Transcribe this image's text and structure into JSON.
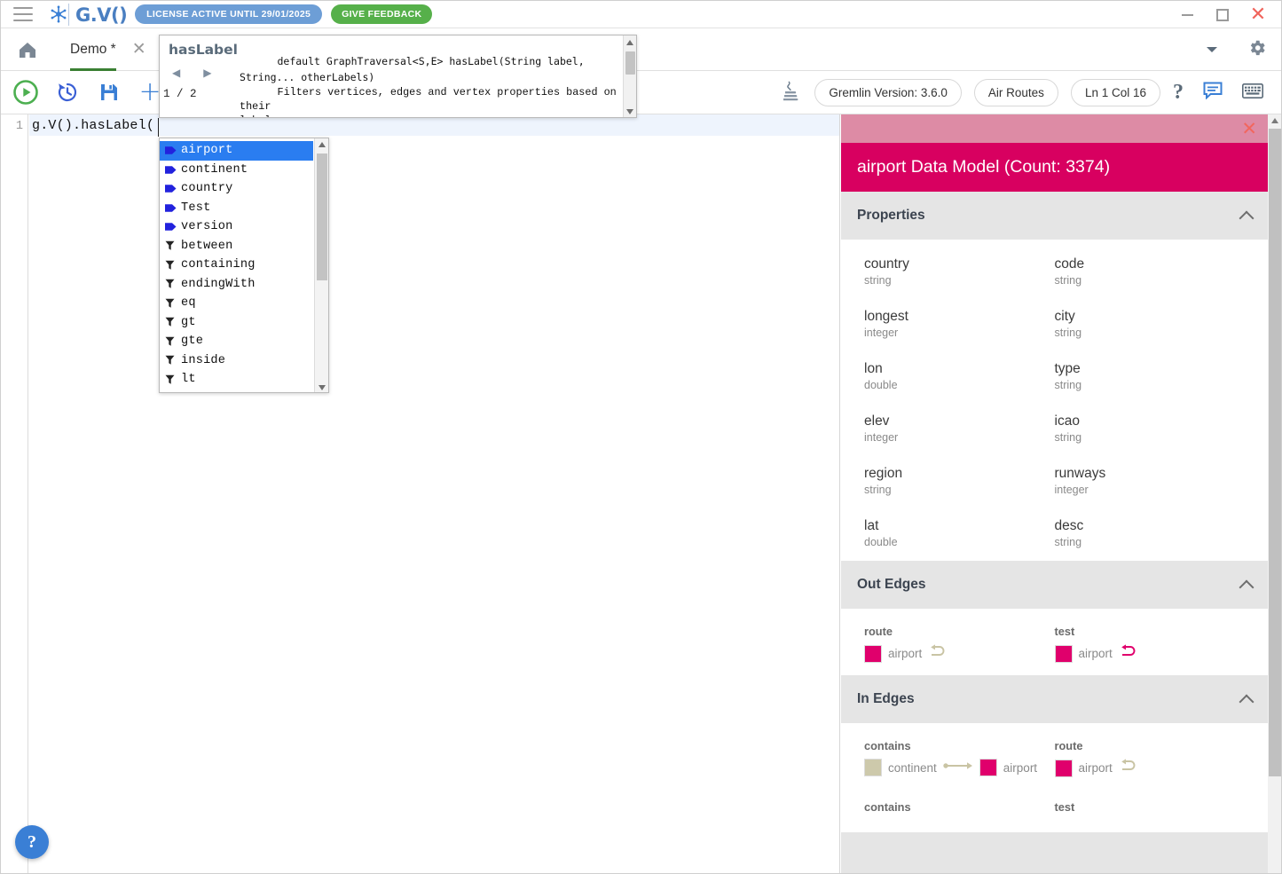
{
  "titlebar": {
    "menu_icon": "hamburger-icon",
    "brand": "G.V()",
    "license_badge": "LICENSE ACTIVE UNTIL 29/01/2025",
    "feedback_button": "GIVE FEEDBACK",
    "window_controls": {
      "minimize": "minimize-icon",
      "maximize": "maximize-icon",
      "close": "close-icon"
    },
    "colors": {
      "brand_blue": "#4a7fc1",
      "license_blue": "#6d9ed6",
      "feedback_green": "#56b04a",
      "close_red": "#f0645c"
    }
  },
  "tabbar": {
    "home_icon": "home-icon",
    "tabs": [
      {
        "label": "Demo *",
        "active": true,
        "close_icon": "close-icon"
      }
    ],
    "overflow_icon": "chevron-down-icon",
    "settings_icon": "gear-icon",
    "active_underline_color": "#3a7f33"
  },
  "toolbar": {
    "left_icons": [
      {
        "name": "run-query-button",
        "label": "run"
      },
      {
        "name": "query-history-button",
        "label": "history"
      },
      {
        "name": "save-query-button",
        "label": "save"
      },
      {
        "name": "new-query-button",
        "label": "+"
      }
    ],
    "language_icon": "java-icon",
    "chips": [
      {
        "name": "gremlin-version-chip",
        "label": "Gremlin Version: 3.6.0"
      },
      {
        "name": "connection-chip",
        "label": "Air Routes"
      },
      {
        "name": "cursor-position-chip",
        "label": "Ln 1 Col 16"
      }
    ],
    "right_icons": [
      {
        "name": "help-icon",
        "glyph": "?"
      },
      {
        "name": "chat-icon",
        "glyph": "speech-bubble"
      },
      {
        "name": "keyboard-icon",
        "glyph": "keyboard"
      }
    ]
  },
  "editor": {
    "line_number": "1",
    "code": "g.V().hasLabel(",
    "help_fab": "?"
  },
  "doc_tooltip": {
    "name": "hasLabel",
    "prev_arrow": "◀",
    "next_arrow": "▶",
    "page_counter": "1 / 2",
    "signature": "default GraphTraversal<S,E> hasLabel(String label,\nString... otherLabels)",
    "description": "Filters vertices, edges and vertex properties based on their\nlabel.\nParameters:\n    label - the label of the Element."
  },
  "autocomplete": {
    "items": [
      {
        "label": "airport",
        "icon": "vertex-label-icon",
        "selected": true
      },
      {
        "label": "continent",
        "icon": "vertex-label-icon",
        "selected": false
      },
      {
        "label": "country",
        "icon": "vertex-label-icon",
        "selected": false
      },
      {
        "label": "Test",
        "icon": "vertex-label-icon",
        "selected": false
      },
      {
        "label": "version",
        "icon": "vertex-label-icon",
        "selected": false
      },
      {
        "label": "between",
        "icon": "predicate-filter-icon",
        "selected": false
      },
      {
        "label": "containing",
        "icon": "predicate-filter-icon",
        "selected": false
      },
      {
        "label": "endingWith",
        "icon": "predicate-filter-icon",
        "selected": false
      },
      {
        "label": "eq",
        "icon": "predicate-filter-icon",
        "selected": false
      },
      {
        "label": "gt",
        "icon": "predicate-filter-icon",
        "selected": false
      },
      {
        "label": "gte",
        "icon": "predicate-filter-icon",
        "selected": false
      },
      {
        "label": "inside",
        "icon": "predicate-filter-icon",
        "selected": false
      },
      {
        "label": "lt",
        "icon": "predicate-filter-icon",
        "selected": false
      }
    ],
    "selected_color": "#2a7df0",
    "vertex_icon_color": "#2222dd"
  },
  "data_model_panel": {
    "close_icon": "close-icon",
    "title": "airport Data Model (Count: 3374)",
    "header_color": "#d80060",
    "sections": {
      "properties": {
        "title": "Properties",
        "collapse_icon": "chevron-up-icon",
        "items": [
          {
            "name": "country",
            "type": "string"
          },
          {
            "name": "code",
            "type": "string"
          },
          {
            "name": "longest",
            "type": "integer"
          },
          {
            "name": "city",
            "type": "string"
          },
          {
            "name": "lon",
            "type": "double"
          },
          {
            "name": "type",
            "type": "string"
          },
          {
            "name": "elev",
            "type": "integer"
          },
          {
            "name": "icao",
            "type": "string"
          },
          {
            "name": "region",
            "type": "string"
          },
          {
            "name": "runways",
            "type": "integer"
          },
          {
            "name": "lat",
            "type": "double"
          },
          {
            "name": "desc",
            "type": "string"
          }
        ]
      },
      "out_edges": {
        "title": "Out Edges",
        "collapse_icon": "chevron-up-icon",
        "items": [
          {
            "label": "route",
            "source": null,
            "target": "airport",
            "target_color": "#e0006c",
            "self_loop": true,
            "arrow_color": "#c9c4a4"
          },
          {
            "label": "test",
            "source": null,
            "target": "airport",
            "target_color": "#e0006c",
            "self_loop": true,
            "arrow_color": "#e0006c"
          }
        ]
      },
      "in_edges": {
        "title": "In Edges",
        "collapse_icon": "chevron-up-icon",
        "items": [
          {
            "label": "contains",
            "source": "continent",
            "source_color": "#cdc9ab",
            "target": "airport",
            "target_color": "#e0006c",
            "self_loop": false,
            "arrow_color": "#c9c4a4"
          },
          {
            "label": "route",
            "source": null,
            "target": "airport",
            "target_color": "#e0006c",
            "self_loop": true,
            "arrow_color": "#c9c4a4"
          },
          {
            "label": "contains",
            "source": null,
            "target": null,
            "self_loop": false,
            "arrow_color": "#c9c4a4"
          },
          {
            "label": "test",
            "source": null,
            "target": null,
            "self_loop": false,
            "arrow_color": "#e0006c"
          }
        ]
      }
    }
  }
}
